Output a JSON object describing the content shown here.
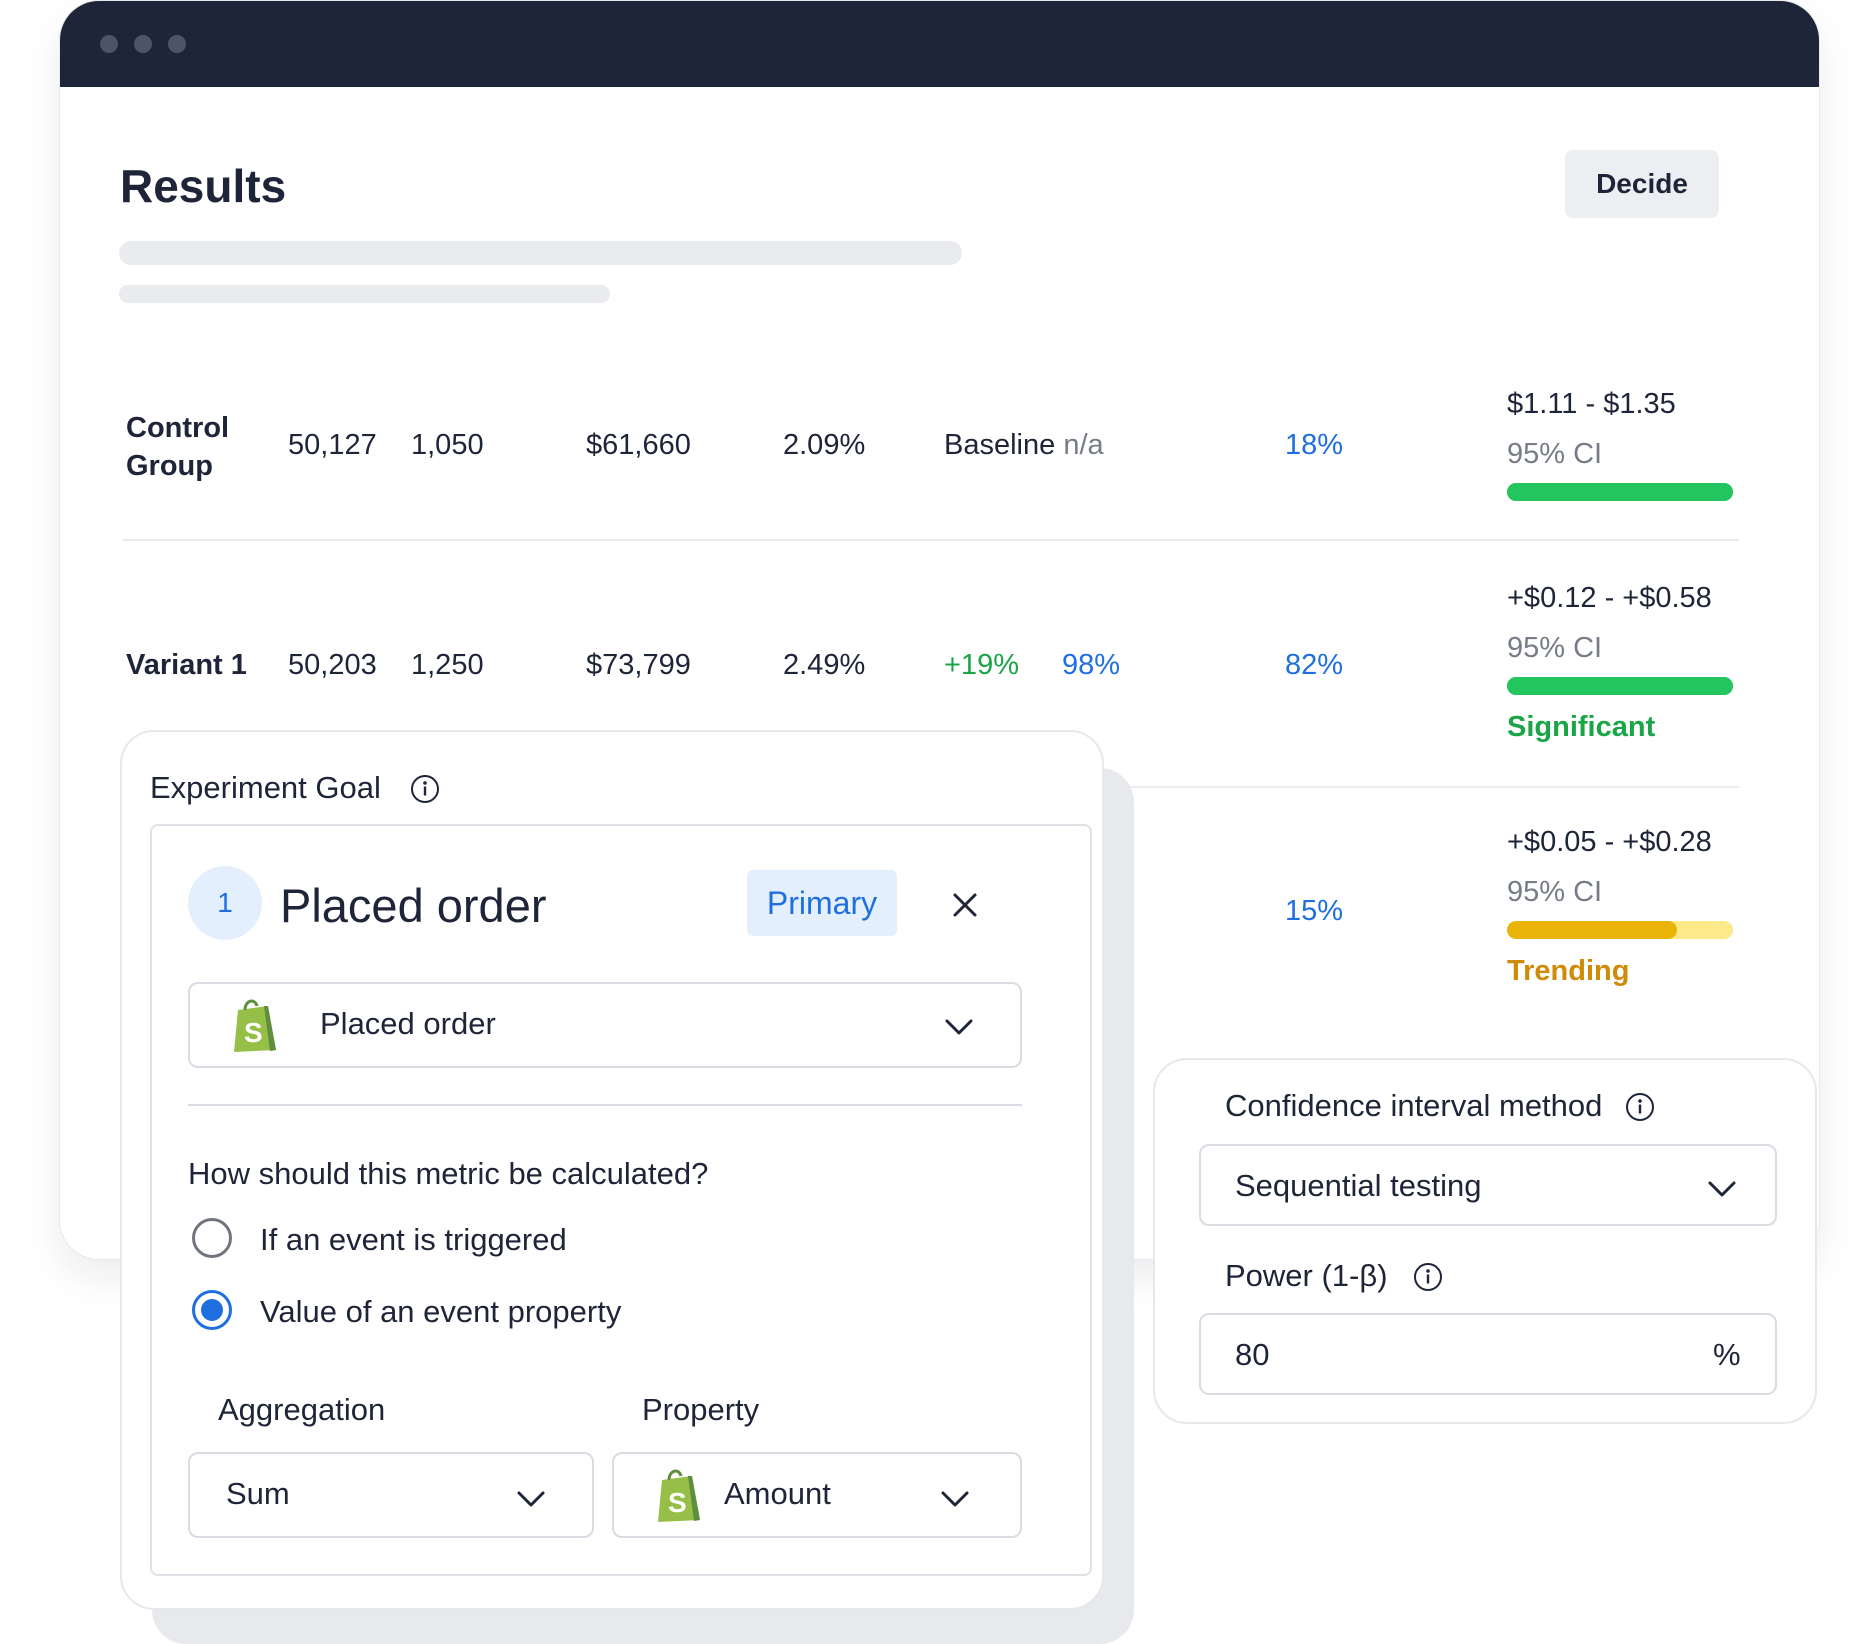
{
  "results": {
    "title": "Results",
    "decide_label": "Decide",
    "rows": [
      {
        "name": "Control\nGroup",
        "visitors": "50,127",
        "conversions": "1,050",
        "revenue": "$61,660",
        "rate": "2.09%",
        "lift": "Baseline",
        "lift_extra": "n/a",
        "probability": "18%",
        "ci_range": "$1.11 - $1.35",
        "ci_label": "95% CI",
        "bar_color": "#22c55e",
        "bar_fill": 1.0
      },
      {
        "name": "Variant 1",
        "visitors": "50,203",
        "conversions": "1,250",
        "revenue": "$73,799",
        "rate": "2.49%",
        "lift": "+19%",
        "lift_extra": "98%",
        "probability": "82%",
        "ci_range": "+$0.12 - +$0.58",
        "ci_label": "95% CI",
        "bar_color": "#22c55e",
        "bar_fill": 1.0,
        "status": "Significant",
        "status_color": "#1aa547"
      },
      {
        "probability": "15%",
        "ci_range": "+$0.05 - +$0.28",
        "ci_label": "95% CI",
        "bar_color": "#eab308",
        "bar_track_color": "#fce98a",
        "bar_fill": 0.75,
        "status": "Trending",
        "status_color": "#cf8a08"
      }
    ]
  },
  "goal": {
    "heading": "Experiment Goal",
    "step_number": "1",
    "title": "Placed order",
    "badge": "Primary",
    "event_select": "Placed order",
    "question": "How should this metric be calculated?",
    "options": [
      {
        "label": "If an event is triggered",
        "selected": false
      },
      {
        "label": "Value of an event property",
        "selected": true
      }
    ],
    "aggregation_label": "Aggregation",
    "aggregation_value": "Sum",
    "property_label": "Property",
    "property_value": "Amount"
  },
  "settings": {
    "ci_method_label": "Confidence interval method",
    "ci_method_value": "Sequential testing",
    "power_label": "Power (1-β)",
    "power_value": "80",
    "power_unit": "%"
  },
  "colors": {
    "accent_blue": "#1f6fe0",
    "success_green": "#1aa547",
    "warning_orange": "#cf8a08",
    "titlebar": "#1e2538"
  },
  "icons": [
    "info-icon",
    "close-icon",
    "chevron-down-icon",
    "shopify-bag-icon"
  ]
}
